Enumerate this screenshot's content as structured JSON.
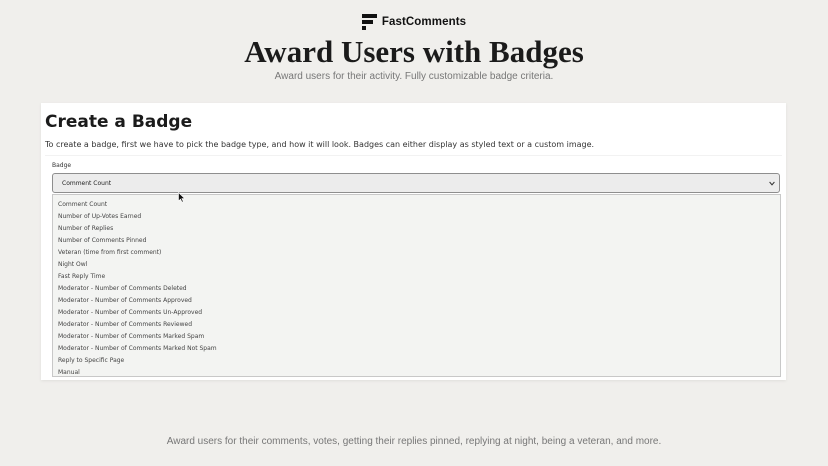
{
  "header": {
    "brand_name": "FastComments",
    "brand_icon": "fastcomments-logo-icon",
    "title": "Award Users with Badges",
    "subtitle": "Award users for their activity. Fully customizable badge criteria."
  },
  "card": {
    "title": "Create a Badge",
    "description": "To create a badge, first we have to pick the badge type, and how it will look. Badges can either display as styled text or a custom image.",
    "badge_field": {
      "label": "Badge",
      "selected": "Comment Count",
      "expanded": true,
      "options": [
        "Comment Count",
        "Number of Up-Votes Earned",
        "Number of Replies",
        "Number of Comments Pinned",
        "Veteran (time from first comment)",
        "Night Owl",
        "Fast Reply Time",
        "Moderator - Number of Comments Deleted",
        "Moderator - Number of Comments Approved",
        "Moderator - Number of Comments Un-Approved",
        "Moderator - Number of Comments Reviewed",
        "Moderator - Number of Comments Marked Spam",
        "Moderator - Number of Comments Marked Not Spam",
        "Reply to Specific Page",
        "Manual"
      ]
    }
  },
  "footer": {
    "text": "Award users for their comments, votes, getting their replies pinned, replying at night, being a veteran, and more."
  },
  "colors": {
    "page_background": "#f0efec",
    "card_background": "#ffffff",
    "select_background": "#ececec",
    "listbox_background": "#f3f4f2"
  }
}
